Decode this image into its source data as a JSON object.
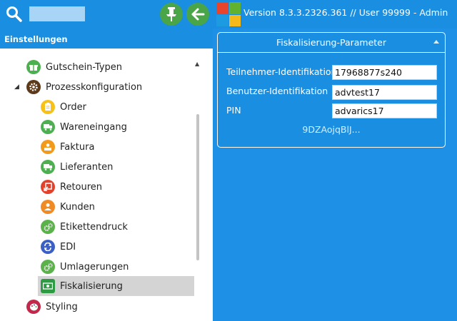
{
  "topbar": {
    "search_placeholder": "",
    "version_text": "Version 8.3.3.2326.361 // User 99999 - Admin"
  },
  "sidebar": {
    "header": "Einstellungen",
    "items": [
      {
        "label": "Gutschein-Typen",
        "icon": "gift-icon",
        "color": "#4caf50"
      },
      {
        "label": "Prozesskonfiguration",
        "icon": "gear-icon",
        "color": "#5d3a1a"
      },
      {
        "label": "Order",
        "icon": "clipboard-icon",
        "color": "#f6c21a"
      },
      {
        "label": "Wareneingang",
        "icon": "truck-icon",
        "color": "#4caf50"
      },
      {
        "label": "Faktura",
        "icon": "invoice-icon",
        "color": "#f29a1c"
      },
      {
        "label": "Lieferanten",
        "icon": "truck-icon",
        "color": "#4caf50"
      },
      {
        "label": "Retouren",
        "icon": "return-icon",
        "color": "#e2422c"
      },
      {
        "label": "Kunden",
        "icon": "person-icon",
        "color": "#f08a24"
      },
      {
        "label": "Etikettendruck",
        "icon": "gears-icon",
        "color": "#5bb14a"
      },
      {
        "label": "EDI",
        "icon": "sync-icon",
        "color": "#3b5fc4"
      },
      {
        "label": "Umlagerungen",
        "icon": "gears-icon",
        "color": "#5bb14a"
      },
      {
        "label": "Fiskalisierung",
        "icon": "money-icon",
        "color": "#2f9a44"
      },
      {
        "label": "Styling",
        "icon": "palette-icon",
        "color": "#c2284a"
      }
    ]
  },
  "panel": {
    "title": "Fiskalisierung-Parameter",
    "fields": [
      {
        "label": "Teilnehmer-Identifikation",
        "value": "17968877s240"
      },
      {
        "label": "Benutzer-Identifikation",
        "value": "advtest17"
      },
      {
        "label": "PIN",
        "value": "advarics17"
      }
    ],
    "link": "9DZAojqBlJ..."
  }
}
